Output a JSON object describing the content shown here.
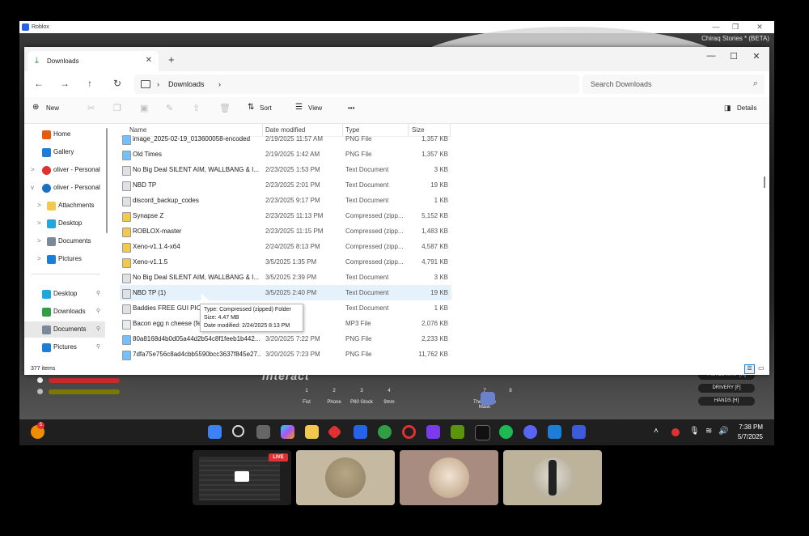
{
  "roblox": {
    "title": "Roblox",
    "subtitle": "Chiraq Stories * (BETA)",
    "controls": {
      "minimize": "—",
      "restore": "❐",
      "close": "✕"
    },
    "hud": {
      "slots": [
        {
          "key": "1",
          "label": "Fist"
        },
        {
          "key": "2",
          "label": "Phone"
        },
        {
          "key": "3",
          "label": "P80 Glock"
        },
        {
          "key": "4",
          "label": "9mm"
        },
        {
          "key": "7",
          "label": "The Purge Mask"
        },
        {
          "key": "8",
          "label": ""
        }
      ],
      "right_labels": [
        "PISTOL WHIP [R]",
        "DRIVERY [F]",
        "HANDS [H]"
      ],
      "watermark": "interact",
      "bar_colors": [
        "#c92a2a",
        "#7a7a00"
      ]
    }
  },
  "explorer": {
    "tab": {
      "label": "Downloads",
      "icon": "download-icon"
    },
    "new_tab": "+",
    "window_controls": {
      "minimize": "—",
      "maximize": "☐",
      "close": "✕"
    },
    "breadcrumb": {
      "root_sep": "›",
      "folder": "Downloads",
      "trail_sep": "›"
    },
    "search_placeholder": "Search Downloads",
    "toolbar": {
      "new": "New",
      "sort": "Sort",
      "view": "View",
      "more": "•••",
      "details": "Details"
    },
    "sidebar": [
      {
        "label": "Home",
        "icon": "home-icon",
        "color": "#e8590c"
      },
      {
        "label": "Gallery",
        "icon": "gallery-icon",
        "color": "#1c7ed6"
      },
      {
        "label": "oliver - Personal",
        "icon": "profile-icon",
        "color": "#e03131",
        "chevron": ">"
      },
      {
        "label": "oliver - Personal",
        "icon": "cloud-icon",
        "color": "#1971c2",
        "chevron": "v"
      },
      {
        "label": "Attachments",
        "icon": "folder-icon",
        "color": "#f2c94c",
        "chevron": ">"
      },
      {
        "label": "Desktop",
        "icon": "desktop-icon",
        "color": "#22a6df",
        "chevron": ">"
      },
      {
        "label": "Documents",
        "icon": "documents-icon",
        "color": "#7b8a99",
        "chevron": ">"
      },
      {
        "label": "Pictures",
        "icon": "pictures-icon",
        "color": "#1c7ed6",
        "chevron": ">"
      },
      {
        "label": "Desktop",
        "icon": "desktop-icon",
        "color": "#22a6df",
        "pin": "📌"
      },
      {
        "label": "Downloads",
        "icon": "download-icon",
        "color": "#2f9e44",
        "pin": "📌"
      },
      {
        "label": "Documents",
        "icon": "documents-icon",
        "color": "#7b8a99",
        "pin": "📌"
      },
      {
        "label": "Pictures",
        "icon": "pictures-icon",
        "color": "#1c7ed6",
        "pin": "📌"
      }
    ],
    "columns": {
      "name": "Name",
      "date": "Date modified",
      "type": "Type",
      "size": "Size"
    },
    "files": [
      {
        "name": "image_2025-02-19_013600058-encoded",
        "date": "2/19/2025 11:57 AM",
        "type": "PNG File",
        "size": "1,357 KB",
        "icon": "image-file-icon"
      },
      {
        "name": "Old Times",
        "date": "2/19/2025 1:42 AM",
        "type": "PNG File",
        "size": "1,357 KB",
        "icon": "image-file-icon"
      },
      {
        "name": "No Big Deal SILENT AIM, WALLBANG & I...",
        "date": "2/23/2025 1:53 PM",
        "type": "Text Document",
        "size": "3 KB",
        "icon": "text-file-icon"
      },
      {
        "name": "NBD TP",
        "date": "2/23/2025 2:01 PM",
        "type": "Text Document",
        "size": "19 KB",
        "icon": "text-file-icon"
      },
      {
        "name": "discord_backup_codes",
        "date": "2/23/2025 9:17 PM",
        "type": "Text Document",
        "size": "1 KB",
        "icon": "text-file-icon"
      },
      {
        "name": "Synapse Z",
        "date": "2/23/2025 11:13 PM",
        "type": "Compressed (zipp...",
        "size": "5,152 KB",
        "icon": "zip-folder-icon"
      },
      {
        "name": "ROBLOX-master",
        "date": "2/23/2025 11:15 PM",
        "type": "Compressed (zipp...",
        "size": "1,483 KB",
        "icon": "zip-folder-icon"
      },
      {
        "name": "Xeno-v1.1.4-x64",
        "date": "2/24/2025 8:13 PM",
        "type": "Compressed (zipp...",
        "size": "4,587 KB",
        "icon": "zip-folder-icon"
      },
      {
        "name": "Xeno-v1.1.5",
        "date": "3/5/2025 1:35 PM",
        "type": "Compressed (zipp...",
        "size": "4,791 KB",
        "icon": "zip-folder-icon"
      },
      {
        "name": "No Big Deal SILENT AIM, WALLBANG & I...",
        "date": "3/5/2025 2:39 PM",
        "type": "Text Document",
        "size": "3 KB",
        "icon": "text-file-icon"
      },
      {
        "name": "NBD TP (1)",
        "date": "3/5/2025 2:40 PM",
        "type": "Text Document",
        "size": "19 KB",
        "icon": "text-file-icon",
        "highlight": true
      },
      {
        "name": "Baddies FREE GUI PICK...",
        "date": "PM",
        "type": "Text Document",
        "size": "1 KB",
        "icon": "text-file-icon"
      },
      {
        "name": "Bacon egg n cheese (fe...",
        "date": "PM",
        "type": "MP3 File",
        "size": "2,076 KB",
        "icon": "audio-file-icon"
      },
      {
        "name": "80a8168d4b0d05a44d2b54c8f1feeb1b442...",
        "date": "3/20/2025 7:22 PM",
        "type": "PNG File",
        "size": "2,233 KB",
        "icon": "image-file-icon"
      },
      {
        "name": "7dfa75e756c8ad4cbb5590bcc3637f845e27...",
        "date": "3/20/2025 7:23 PM",
        "type": "PNG File",
        "size": "11,762 KB",
        "icon": "image-file-icon"
      }
    ],
    "tooltip": {
      "type": "Type: Compressed (zipped) Folder",
      "size": "Size: 4.47 MB",
      "date": "Date modified: 2/24/2025 8:13 PM"
    },
    "status": "377 items"
  },
  "taskbar": {
    "time": "7:38 PM",
    "date": "5/7/2025",
    "weather_badge": "5",
    "apps": [
      "start-icon",
      "search-icon",
      "task-view-icon",
      "copilot-icon",
      "file-explorer-icon",
      "app-red-icon",
      "store-icon",
      "chrome-icon",
      "opera-icon",
      "game-icon",
      "minecraft-icon",
      "terminal-icon",
      "spotify-icon",
      "discord-icon",
      "defender-icon",
      "roblox-icon"
    ],
    "tray": [
      "chevron-up-icon",
      "mcafee-icon",
      "microphone-icon",
      "wifi-icon",
      "volume-icon"
    ]
  },
  "call": {
    "live_label": "LIVE",
    "tiles": [
      "screen-share-tile",
      "participant-tile-1",
      "participant-tile-2",
      "participant-tile-3"
    ]
  }
}
